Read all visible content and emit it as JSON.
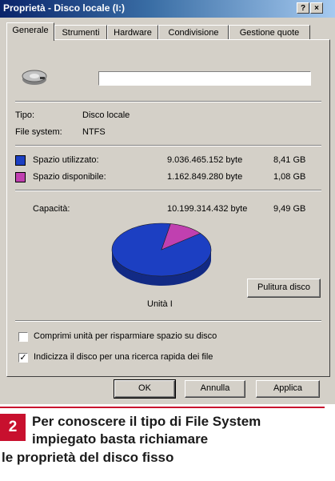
{
  "window": {
    "title": "Proprietà - Disco locale (I:)",
    "help_glyph": "?",
    "close_glyph": "×"
  },
  "tabs": [
    {
      "label": "Generale",
      "active": true
    },
    {
      "label": "Strumenti",
      "active": false
    },
    {
      "label": "Hardware",
      "active": false
    },
    {
      "label": "Condivisione",
      "active": false
    },
    {
      "label": "Gestione quote",
      "active": false
    }
  ],
  "general": {
    "drive_icon": "hard-drive-icon",
    "name_value": "",
    "type_label": "Tipo:",
    "type_value": "Disco locale",
    "fs_label": "File system:",
    "fs_value": "NTFS"
  },
  "space": {
    "used": {
      "label": "Spazio utilizzato:",
      "bytes": "9.036.465.152 byte",
      "size": "8,41 GB",
      "color": "#1c3fc2"
    },
    "free": {
      "label": "Spazio disponibile:",
      "bytes": "1.162.849.280 byte",
      "size": "1,08 GB",
      "color": "#c040b0"
    },
    "capacity": {
      "label": "Capacità:",
      "bytes": "10.199.314.432 byte",
      "size": "9,49 GB"
    }
  },
  "chart_data": {
    "type": "pie",
    "title": "",
    "categories": [
      "Spazio utilizzato",
      "Spazio disponibile"
    ],
    "values": [
      9036465152,
      1162849280
    ],
    "colors": [
      "#1c3fc2",
      "#c040b0"
    ]
  },
  "drive_label": "Unità I",
  "cleanup_button": "Pulitura disco",
  "options": [
    {
      "label": "Comprimi unità per risparmiare spazio su disco",
      "checked": false
    },
    {
      "label": "Indicizza il disco per una ricerca rapida dei file",
      "checked": true
    }
  ],
  "footer_buttons": {
    "ok": "OK",
    "cancel": "Annulla",
    "apply": "Applica"
  },
  "caption": {
    "number": "2",
    "line1": "Per conoscere il tipo di File System",
    "line2": "impiegato basta richiamare",
    "line3": "le proprietà del disco fisso"
  }
}
